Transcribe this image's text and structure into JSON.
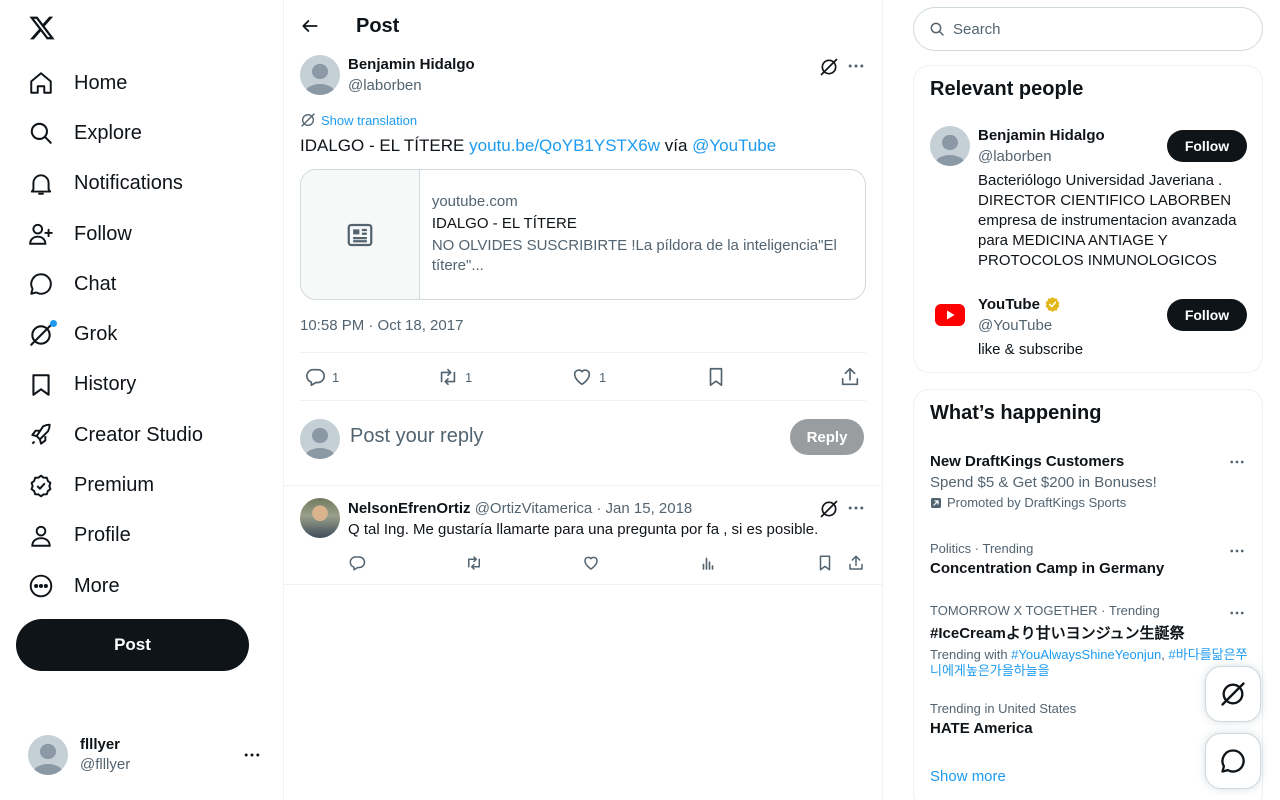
{
  "nav": {
    "items": [
      {
        "label": "Home",
        "icon": "home-icon"
      },
      {
        "label": "Explore",
        "icon": "search-icon"
      },
      {
        "label": "Notifications",
        "icon": "bell-icon"
      },
      {
        "label": "Follow",
        "icon": "person-plus-icon"
      },
      {
        "label": "Chat",
        "icon": "chat-bubble-icon"
      },
      {
        "label": "Grok",
        "icon": "grok-icon"
      },
      {
        "label": "History",
        "icon": "bookmark-icon"
      },
      {
        "label": "Creator Studio",
        "icon": "rocket-icon"
      },
      {
        "label": "Premium",
        "icon": "verified-badge-icon"
      },
      {
        "label": "Profile",
        "icon": "person-icon"
      },
      {
        "label": "More",
        "icon": "more-circle-icon"
      }
    ],
    "post_label": "Post"
  },
  "account": {
    "name": "flllyer",
    "handle": "@flllyer"
  },
  "header": {
    "title": "Post"
  },
  "tweet": {
    "author_name": "Benjamin Hidalgo",
    "author_handle": "@laborben",
    "translate_label": "Show translation",
    "text_prefix": "IDALGO - EL TÍTERE ",
    "link_url": "youtu.be/QoYB1YSTX6w",
    "text_via": " vía ",
    "mention": "@YouTube",
    "card": {
      "domain": "youtube.com",
      "title": "IDALGO - EL TÍTERE",
      "description": "NO OLVIDES SUSCRIBIRTE !La píldora de la inteligencia\"El títere\"..."
    },
    "timestamp": "10:58 PM · Oct 18, 2017",
    "counts": {
      "replies": "1",
      "reposts": "1",
      "likes": "1"
    }
  },
  "reply_box": {
    "placeholder": "Post your reply",
    "button": "Reply"
  },
  "reply": {
    "name": "NelsonEfrenOrtiz",
    "handle": "@OrtizVitamerica",
    "separator": " · ",
    "date": "Jan 15, 2018",
    "text": "Q tal Ing. Me gustaría llamarte para una pregunta por fa , si es posible."
  },
  "search": {
    "placeholder": "Search"
  },
  "relevant_people": {
    "title": "Relevant people",
    "people": [
      {
        "name": "Benjamin Hidalgo",
        "handle": "@laborben",
        "bio": "Bacteriólogo Universidad Javeriana . DIRECTOR CIENTIFICO LABORBEN empresa de instrumentacion avanzada para MEDICINA ANTIAGE Y PROTOCOLOS INMUNOLOGICOS",
        "follow": "Follow"
      },
      {
        "name": "YouTube",
        "handle": "@YouTube",
        "bio": "like & subscribe",
        "follow": "Follow"
      }
    ]
  },
  "happening": {
    "title": "What’s happening",
    "trends": [
      {
        "name": "New DraftKings Customers",
        "sub": "Spend $5 & Get $200 in Bonuses!",
        "promo": "Promoted by DraftKings Sports"
      },
      {
        "meta": "Politics · Trending",
        "name": "Concentration Camp in Germany"
      },
      {
        "meta": "TOMORROW X TOGETHER · Trending",
        "name": "#IceCreamより甘いヨンジュン生誕祭",
        "with_label": "Trending with ",
        "with_1": "#YouAlwaysShineYeonjun",
        "with_sep": ", ",
        "with_2": "#바다를닮은쭈니에게높은가을하늘을"
      },
      {
        "meta": "Trending in United States",
        "name": "HATE America"
      }
    ],
    "show_more": "Show more"
  },
  "colors": {
    "accent": "#1d9bf0",
    "text": "#0f1419",
    "muted": "#536471",
    "youtube_red": "#ff0000",
    "verified_gold": "#e2b719"
  }
}
